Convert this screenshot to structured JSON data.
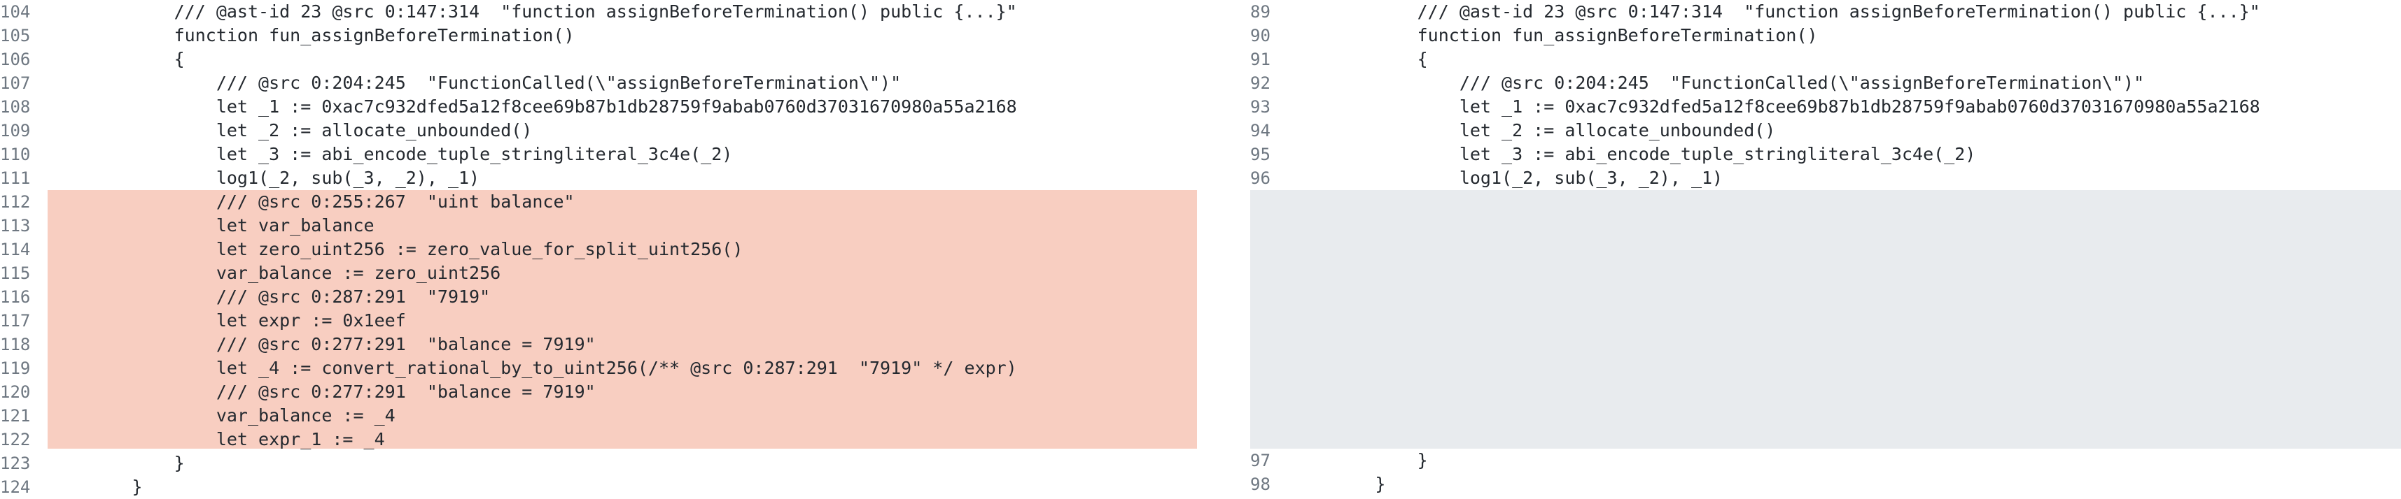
{
  "left": {
    "rows_before": [
      {
        "n": "104",
        "code": "            /// @ast-id 23 @src 0:147:314  \"function assignBeforeTermination() public {...}\""
      },
      {
        "n": "105",
        "code": "            function fun_assignBeforeTermination()"
      },
      {
        "n": "106",
        "code": "            {"
      },
      {
        "n": "107",
        "code": "                /// @src 0:204:245  \"FunctionCalled(\\\"assignBeforeTermination\\\")\""
      },
      {
        "n": "108",
        "code": "                let _1 := 0xac7c932dfed5a12f8cee69b87b1db28759f9abab0760d37031670980a55a2168"
      },
      {
        "n": "109",
        "code": "                let _2 := allocate_unbounded()"
      },
      {
        "n": "110",
        "code": "                let _3 := abi_encode_tuple_stringliteral_3c4e(_2)"
      },
      {
        "n": "111",
        "code": "                log1(_2, sub(_3, _2), _1)"
      }
    ],
    "rows_removed": [
      {
        "n": "112",
        "code": "                /// @src 0:255:267  \"uint balance\""
      },
      {
        "n": "113",
        "code": "                let var_balance"
      },
      {
        "n": "114",
        "code": "                let zero_uint256 := zero_value_for_split_uint256()"
      },
      {
        "n": "115",
        "code": "                var_balance := zero_uint256"
      },
      {
        "n": "116",
        "code": "                /// @src 0:287:291  \"7919\""
      },
      {
        "n": "117",
        "code": "                let expr := 0x1eef"
      },
      {
        "n": "118",
        "code": "                /// @src 0:277:291  \"balance = 7919\""
      },
      {
        "n": "119",
        "code": "                let _4 := convert_rational_by_to_uint256(/** @src 0:287:291  \"7919\" */ expr)"
      },
      {
        "n": "120",
        "code": "                /// @src 0:277:291  \"balance = 7919\""
      },
      {
        "n": "121",
        "code": "                var_balance := _4"
      },
      {
        "n": "122",
        "code": "                let expr_1 := _4"
      }
    ],
    "rows_after": [
      {
        "n": "123",
        "code": "            }"
      },
      {
        "n": "124",
        "code": "        }"
      }
    ]
  },
  "right": {
    "rows_before": [
      {
        "n": "89",
        "code": "            /// @ast-id 23 @src 0:147:314  \"function assignBeforeTermination() public {...}\""
      },
      {
        "n": "90",
        "code": "            function fun_assignBeforeTermination()"
      },
      {
        "n": "91",
        "code": "            {"
      },
      {
        "n": "92",
        "code": "                /// @src 0:204:245  \"FunctionCalled(\\\"assignBeforeTermination\\\")\""
      },
      {
        "n": "93",
        "code": "                let _1 := 0xac7c932dfed5a12f8cee69b87b1db28759f9abab0760d37031670980a55a2168"
      },
      {
        "n": "94",
        "code": "                let _2 := allocate_unbounded()"
      },
      {
        "n": "95",
        "code": "                let _3 := abi_encode_tuple_stringliteral_3c4e(_2)"
      },
      {
        "n": "96",
        "code": "                log1(_2, sub(_3, _2), _1)"
      }
    ],
    "rows_after": [
      {
        "n": "97",
        "code": "            }"
      },
      {
        "n": "98",
        "code": "        }"
      }
    ]
  },
  "colors": {
    "removed_bg": "#f8cec1",
    "placeholder_bg": "#e8ebee",
    "line_number": "#6e7781",
    "text": "#24292f"
  }
}
